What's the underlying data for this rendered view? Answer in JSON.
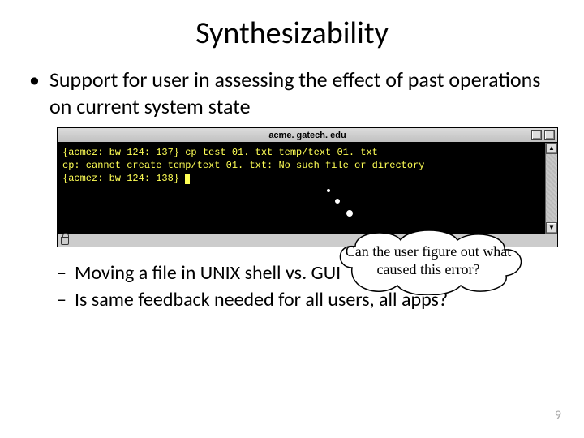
{
  "title": "Synthesizability",
  "bullet1": "Support for user in assessing the effect of past operations on current system state",
  "terminal": {
    "title": "acme. gatech. edu",
    "line1_prompt": "{acmez: bw 124: 137}",
    "line1_cmd": " cp test 01. txt temp/text 01. txt",
    "line2": "cp: cannot create temp/text 01. txt: No such file or directory",
    "line3_prompt": "{acmez: bw 124: 138}"
  },
  "bubble_text": "Can the user figure out what caused this error?",
  "sub1": "Moving a file in UNIX shell vs. GUI",
  "sub2": "Is same feedback needed for all users, all apps?",
  "page_number": "9"
}
